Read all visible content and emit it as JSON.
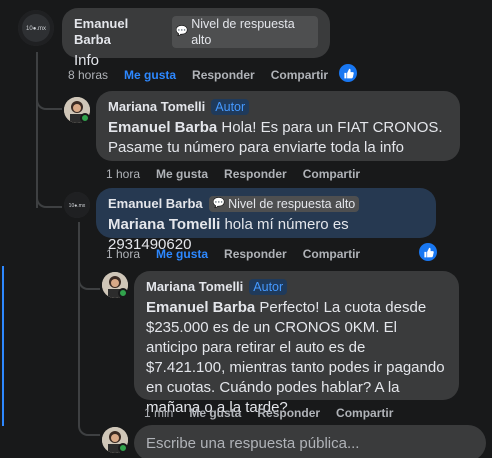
{
  "comments": [
    {
      "author": "Emanuel Barba",
      "badge": "Nivel de respuesta alto",
      "text": "Info",
      "time": "8 horas",
      "like": "Me gusta",
      "reply": "Responder",
      "share": "Compartir"
    },
    {
      "author": "Mariana Tomelli",
      "badge": "Autor",
      "mention": "Emanuel Barba",
      "text": "Hola! Es para un FIAT CRONOS. Pasame tu número para enviarte toda la info",
      "time": "1 hora",
      "like": "Me gusta",
      "reply": "Responder",
      "share": "Compartir"
    },
    {
      "author": "Emanuel Barba",
      "badge": "Nivel de respuesta alto",
      "mention": "Mariana Tomelli",
      "text": "hola mí número es 2931490620",
      "time": "1 hora",
      "like": "Me gusta",
      "reply": "Responder",
      "share": "Compartir"
    },
    {
      "author": "Mariana Tomelli",
      "badge": "Autor",
      "mention": "Emanuel Barba",
      "text": "Perfecto! La cuota desde $235.000 es de un CRONOS 0KM. El anticipo para retirar el auto es de $7.421.100, mientras tanto podes ir pagando en cuotas. Cuándo podes hablar? A la mañana o a la tarde?",
      "time": "1 min",
      "like": "Me gusta",
      "reply": "Responder",
      "share": "Compartir"
    }
  ],
  "reply_input": {
    "placeholder": "Escribe una respuesta pública..."
  },
  "colors": {
    "background": "#18191a",
    "bubble": "#3a3b3c",
    "bubble_highlight": "#263951",
    "accent": "#2d88ff",
    "author_badge": "#4599ff"
  }
}
